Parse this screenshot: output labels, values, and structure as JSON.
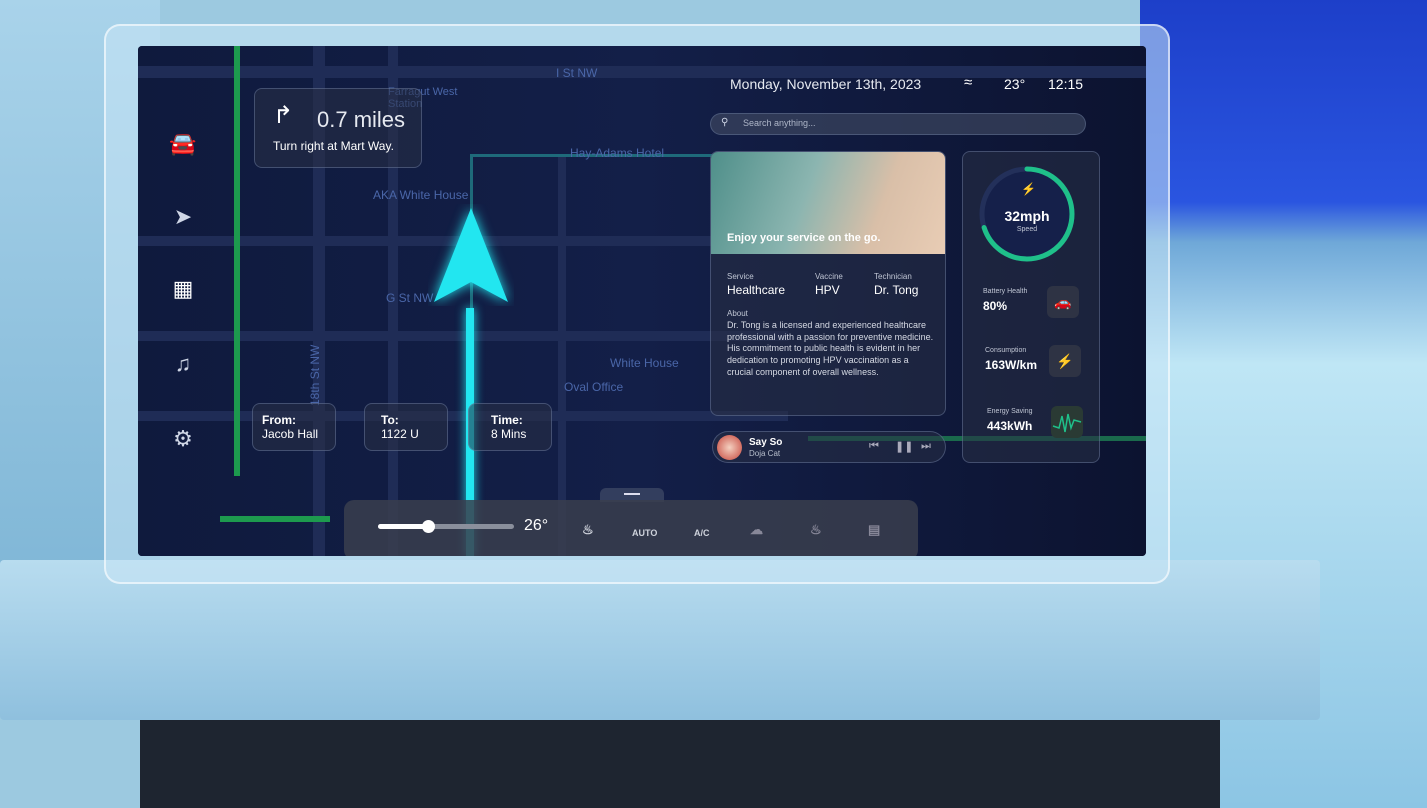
{
  "status_bar": {
    "date": "Monday, November 13th, 2023",
    "temperature": "23°",
    "time": "12:15",
    "wifi_icon": "wifi-icon"
  },
  "search": {
    "placeholder": "Search anything..."
  },
  "sidebar": {
    "items": [
      {
        "icon": "car-icon"
      },
      {
        "icon": "navigation-icon"
      },
      {
        "icon": "grid-icon",
        "active": true
      },
      {
        "icon": "music-icon"
      },
      {
        "icon": "gear-icon"
      }
    ]
  },
  "navigation": {
    "distance": "0.7 miles",
    "instruction": "Turn right at Mart Way.",
    "turn_icon": "turn-right-icon",
    "from_label": "From:",
    "from_value": "Jacob Hall",
    "to_label": "To:",
    "to_value": "1122 U",
    "time_label": "Time:",
    "time_value": "8 Mins"
  },
  "map_labels": [
    "I St NW",
    "Farragut West Station",
    "Hay-Adams Hotel",
    "AKA White House",
    "G St NW",
    "18th St NW",
    "White House",
    "Oval Office"
  ],
  "service_card": {
    "headline": "Enjoy your service on the go.",
    "service_label": "Service",
    "service_value": "Healthcare",
    "vaccine_label": "Vaccine",
    "vaccine_value": "HPV",
    "technician_label": "Technician",
    "technician_value": "Dr. Tong",
    "about_label": "About",
    "about_text": "Dr. Tong is a licensed and experienced healthcare professional with a passion for preventive medicine. His commitment to public health is evident in her dedication to promoting HPV vaccination as a crucial component of overall wellness."
  },
  "music": {
    "title": "Say So",
    "artist": "Doja Cat"
  },
  "stats": {
    "speed": "32mph",
    "speed_label": "Speed",
    "speed_gauge_fraction": 0.7,
    "battery_label": "Battery Health",
    "battery_value": "80%",
    "consumption_label": "Consumption",
    "consumption_value": "163W/km",
    "energy_label": "Energy Saving",
    "energy_value": "443kWh"
  },
  "climate": {
    "temperature": "26°",
    "slider_fraction": 0.37,
    "auto_label": "AUTO",
    "ac_label": "A/C"
  },
  "colors": {
    "accent": "#22e6f0",
    "gauge": "#1fc08a",
    "screen_bg": "#0d1533"
  }
}
